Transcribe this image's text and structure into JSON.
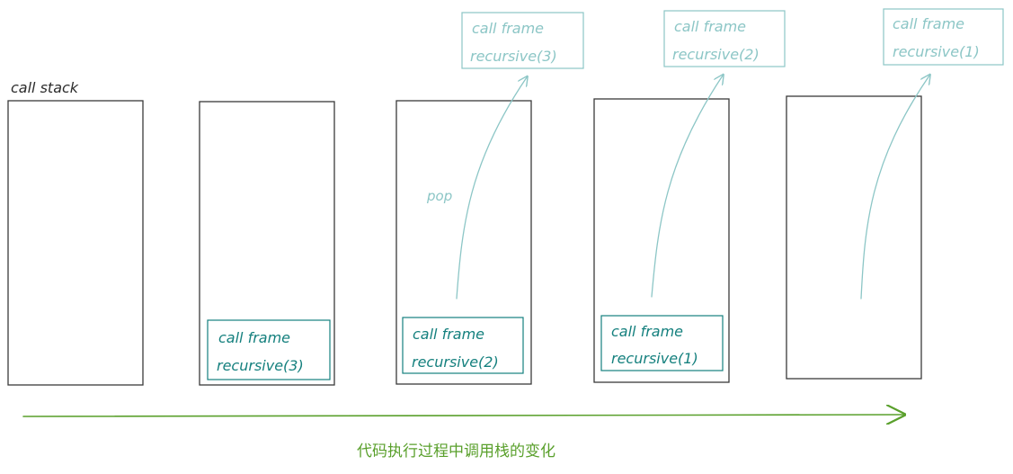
{
  "labels": {
    "call_stack": "call stack",
    "pop": "pop",
    "caption": "代码执行过程中调用栈的变化"
  },
  "frames": {
    "f3_title": "call frame",
    "f3_name": "recursive(3)",
    "f2_title": "call frame",
    "f2_name": "recursive(2)",
    "f1_title": "call frame",
    "f1_name": "recursive(1)"
  },
  "colors": {
    "stack_outline": "#3a3a3a",
    "frame_active": "#15807e",
    "frame_popped": "#8cc6c6",
    "timeline": "#5aa02c"
  }
}
